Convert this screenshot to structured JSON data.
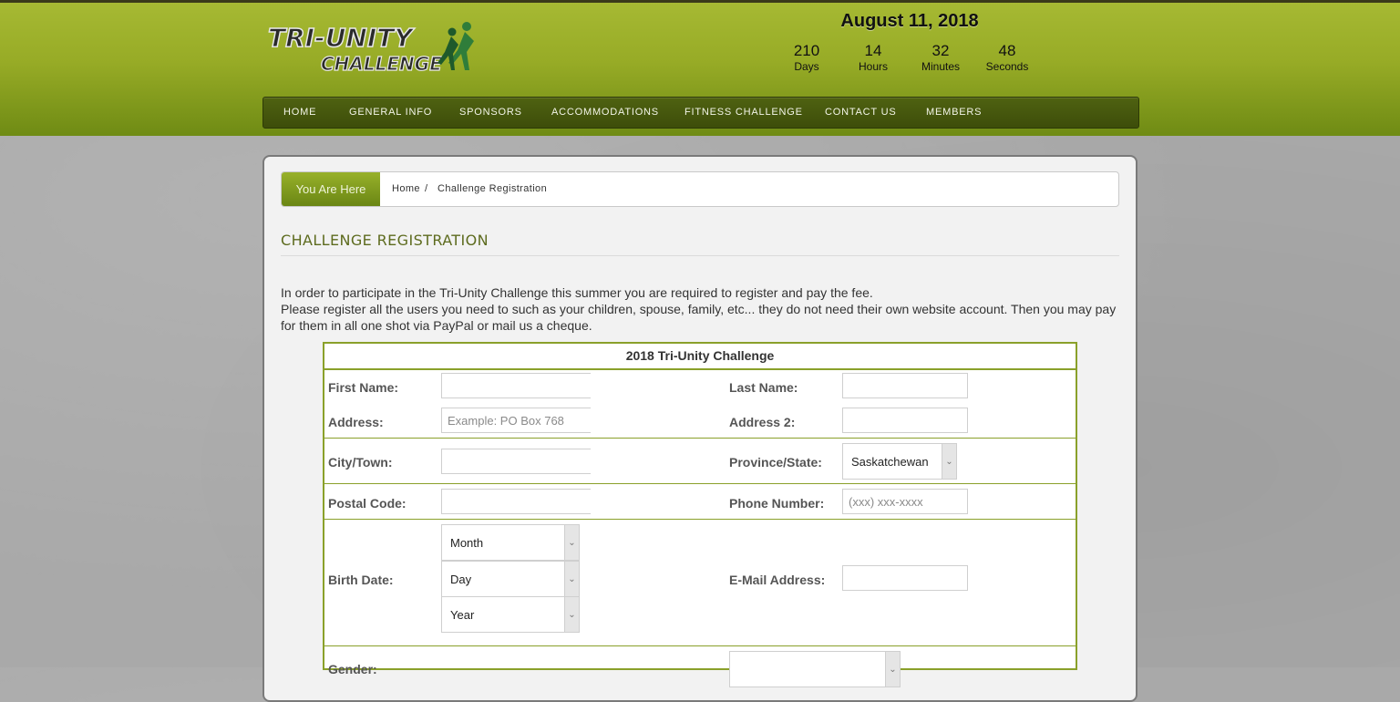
{
  "logo": {
    "line1": "TRI-UNITY",
    "line2": "CHALLENGE"
  },
  "countdown": {
    "date": "August 11, 2018",
    "units": [
      {
        "value": "210",
        "label": "Days"
      },
      {
        "value": "14",
        "label": "Hours"
      },
      {
        "value": "32",
        "label": "Minutes"
      },
      {
        "value": "48",
        "label": "Seconds"
      }
    ]
  },
  "nav": [
    "HOME",
    "GENERAL INFO",
    "SPONSORS",
    "ACCOMMODATIONS",
    "FITNESS CHALLENGE",
    "CONTACT US",
    "MEMBERS"
  ],
  "breadcrumb": {
    "label": "You Are Here",
    "home": "Home",
    "separator": "/",
    "current": "Challenge Registration"
  },
  "page": {
    "title": "CHALLENGE REGISTRATION",
    "intro1": "In order to participate in the Tri-Unity Challenge this summer you are required to register and pay the fee.",
    "intro2": "Please register all the users you need to such as your children, spouse, family, etc... they do not need their own website account. Then you may pay for them in all one shot via PayPal or mail us a cheque."
  },
  "form": {
    "heading": "2018 Tri-Unity Challenge",
    "first_name": {
      "label": "First Name:",
      "value": ""
    },
    "last_name": {
      "label": "Last Name:",
      "value": ""
    },
    "address": {
      "label": "Address:",
      "placeholder": "Example: PO Box 768"
    },
    "address2": {
      "label": "Address 2:",
      "value": ""
    },
    "city": {
      "label": "City/Town:",
      "value": ""
    },
    "province": {
      "label": "Province/State:",
      "selected": "Saskatchewan"
    },
    "postal": {
      "label": "Postal Code:",
      "value": ""
    },
    "phone": {
      "label": "Phone Number:",
      "placeholder": "(xxx) xxx-xxxx"
    },
    "birth": {
      "label": "Birth Date:",
      "month": "Month",
      "day": "Day",
      "year": "Year"
    },
    "email": {
      "label": "E-Mail Address:",
      "value": ""
    },
    "gender": {
      "label": "Gender:"
    }
  }
}
